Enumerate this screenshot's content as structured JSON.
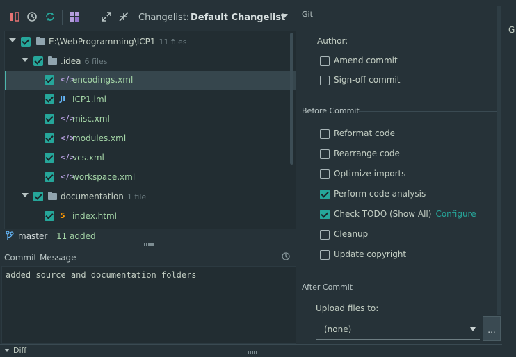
{
  "toolbar": {
    "changelist_label": "Changelist:",
    "changelist_value": "Default Changelist"
  },
  "tree": {
    "root": {
      "name": "E:\\WebProgramming\\ICP1",
      "count": "11 files"
    },
    "idea": {
      "name": ".idea",
      "count": "6 files"
    },
    "files": [
      {
        "name": "encodings.xml",
        "type": "xml"
      },
      {
        "name": "ICP1.iml",
        "type": "iml"
      },
      {
        "name": "misc.xml",
        "type": "xml"
      },
      {
        "name": "modules.xml",
        "type": "xml"
      },
      {
        "name": "vcs.xml",
        "type": "xml"
      },
      {
        "name": "workspace.xml",
        "type": "xml"
      }
    ],
    "documentation": {
      "name": "documentation",
      "count": "1 file"
    },
    "doc_file": {
      "name": "index.html",
      "type": "html"
    }
  },
  "status": {
    "branch": "master",
    "added": "11 added"
  },
  "commit": {
    "label": "Commit Message",
    "message": "added source and documentation folders"
  },
  "diff_label": "Diff",
  "git": {
    "section": "Git",
    "author_label": "Author:",
    "author_value": "",
    "amend": "Amend commit",
    "signoff": "Sign-off commit"
  },
  "before_commit": {
    "section": "Before Commit",
    "reformat": "Reformat code",
    "rearrange": "Rearrange code",
    "optimize": "Optimize imports",
    "analysis": "Perform code analysis",
    "todo": "Check TODO (Show All)",
    "configure": "Configure",
    "cleanup": "Cleanup",
    "copyright": "Update copyright"
  },
  "after_commit": {
    "section": "After Commit",
    "upload_label": "Upload files to:",
    "upload_value": "(none)",
    "browse": "..."
  },
  "right_edge_glyph": "G"
}
